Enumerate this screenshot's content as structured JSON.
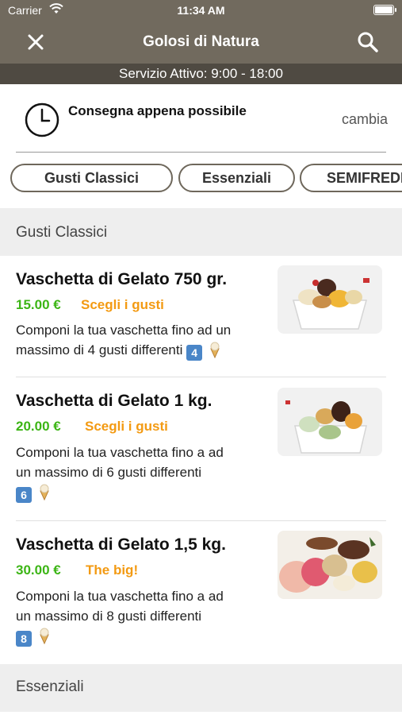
{
  "status_bar": {
    "carrier": "Carrier",
    "time": "11:34 AM"
  },
  "nav": {
    "title": "Golosi di Natura"
  },
  "service": {
    "text": "Servizio Attivo: 9:00 - 18:00"
  },
  "delivery": {
    "label": "Consegna appena possibile",
    "change": "cambia"
  },
  "chips": [
    "Gusti Classici",
    "Essenziali",
    "SEMIFREDDI"
  ],
  "sections": [
    "Gusti Classici",
    "Essenziali"
  ],
  "items": [
    {
      "name": "Vaschetta di Gelato 750 gr.",
      "price": "15.00 €",
      "tag": "Scegli i gusti",
      "desc_line1": "Componi la tua vaschetta fino ad un",
      "desc_line2": "massimo di 4 gusti differenti",
      "count": "4"
    },
    {
      "name": "Vaschetta di Gelato 1 kg.",
      "price": "20.00 €",
      "tag": "Scegli i gusti",
      "desc_line1": "Componi la tua vaschetta fino a ad",
      "desc_line2": "un massimo di 6 gusti differenti",
      "count": "6"
    },
    {
      "name": "Vaschetta di Gelato 1,5 kg.",
      "price": "30.00 €",
      "tag": "The big!",
      "desc_line1": "Componi la tua vaschetta fino a ad",
      "desc_line2": "un massimo di 8 gusti differenti",
      "count": "8"
    }
  ],
  "colors": {
    "header": "#716a5e",
    "service_bar": "#4f4a42",
    "price": "#3cb515",
    "tag": "#f39a12"
  },
  "icons": {
    "close": "close-icon",
    "search": "search-icon",
    "clock": "clock-icon",
    "cone": "ice-cream-icon"
  }
}
